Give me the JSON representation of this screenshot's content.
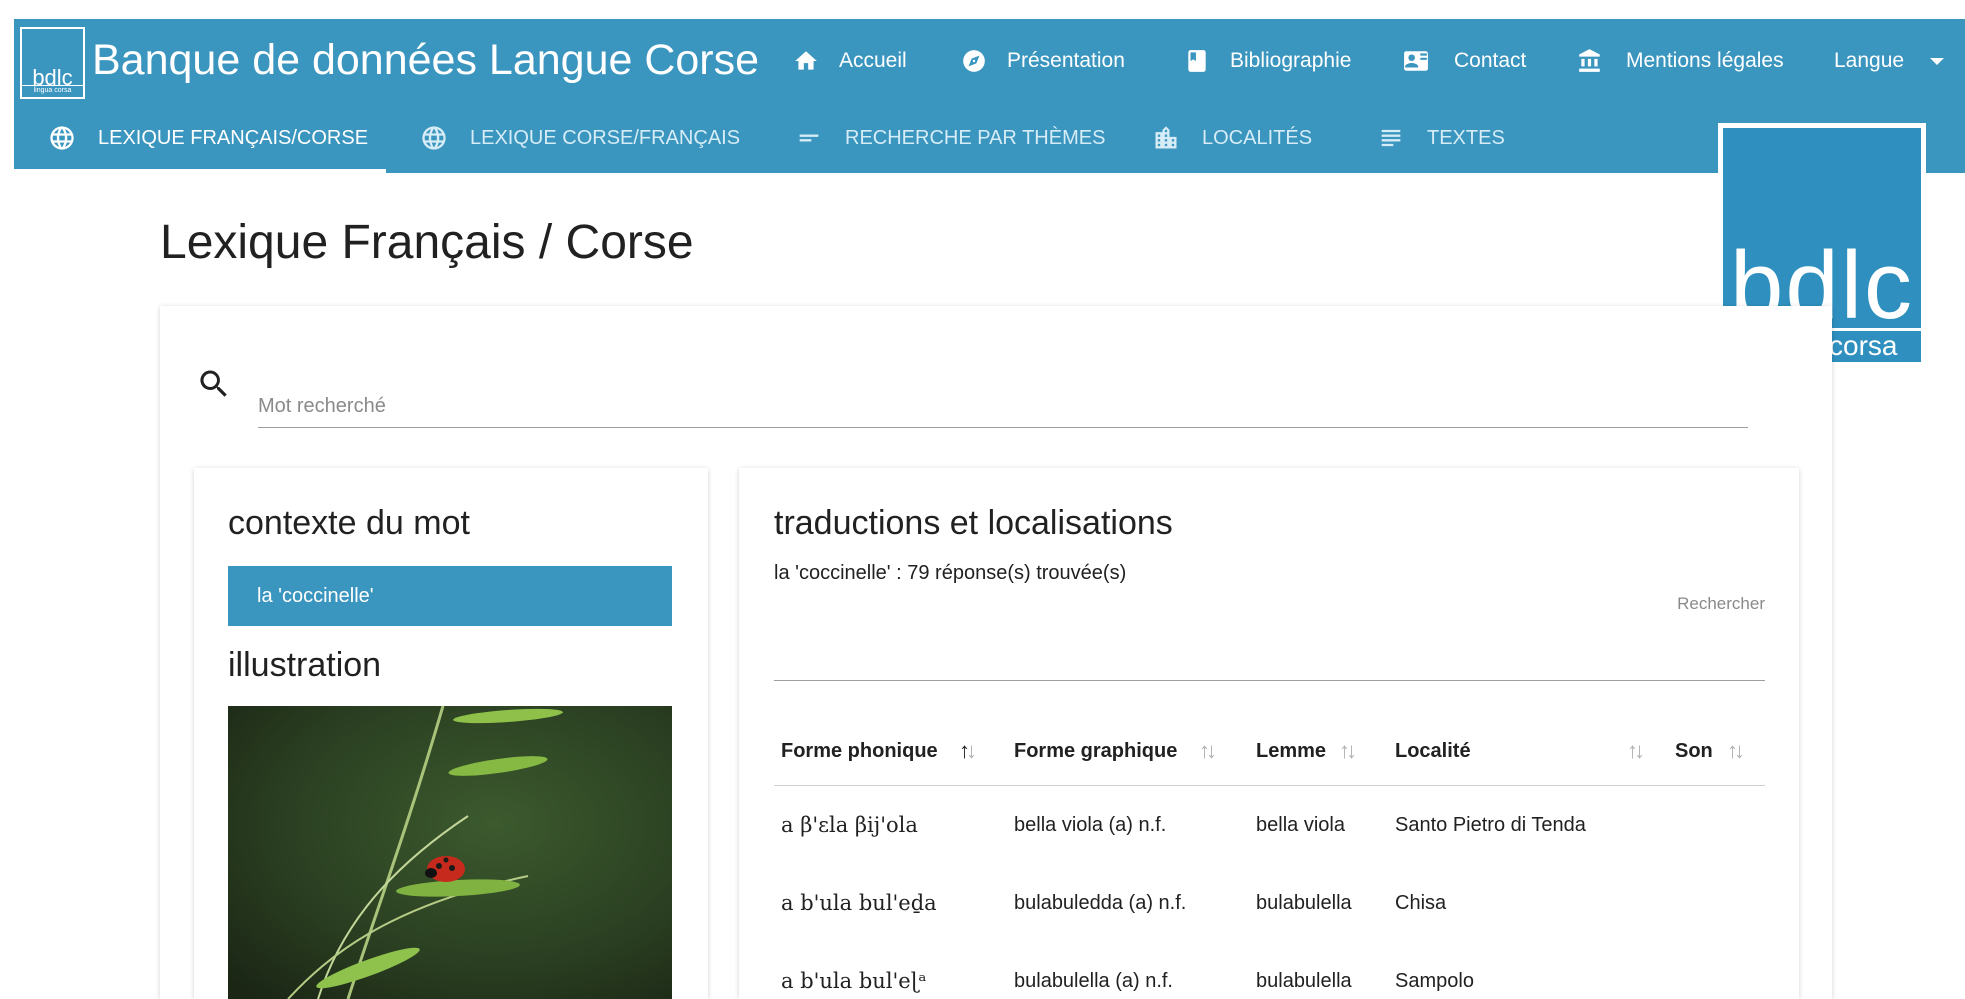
{
  "app": {
    "logo_text": "bdlc",
    "logo_subtext": "lingua corsa",
    "title": "Banque de données Langue Corse"
  },
  "nav": {
    "items": [
      {
        "label": "Accueil",
        "icon": "home-icon"
      },
      {
        "label": "Présentation",
        "icon": "compass-icon"
      },
      {
        "label": "Bibliographie",
        "icon": "book-icon"
      },
      {
        "label": "Contact",
        "icon": "contact-card-icon"
      },
      {
        "label": "Mentions légales",
        "icon": "bank-icon"
      }
    ],
    "language_label": "Langue"
  },
  "tabs": [
    {
      "label": "LEXIQUE FRANÇAIS/CORSE",
      "icon": "globe-icon",
      "active": true
    },
    {
      "label": "LEXIQUE CORSE/FRANÇAIS",
      "icon": "globe-icon",
      "active": false
    },
    {
      "label": "RECHERCHE PAR THÈMES",
      "icon": "short-text-icon",
      "active": false
    },
    {
      "label": "LOCALITÉS",
      "icon": "city-icon",
      "active": false
    },
    {
      "label": "TEXTES",
      "icon": "text-lines-icon",
      "active": false
    }
  ],
  "page": {
    "title": "Lexique Français / Corse"
  },
  "search": {
    "placeholder": "Mot recherché",
    "value": ""
  },
  "context": {
    "heading": "contexte du mot",
    "items": [
      "la 'coccinelle'"
    ],
    "illustration_heading": "illustration"
  },
  "results": {
    "heading": "traductions et localisations",
    "count_text": "la 'coccinelle' : 79 réponse(s) trouvée(s)",
    "search_label": "Rechercher",
    "columns": [
      "Forme phonique",
      "Forme graphique",
      "Lemme",
      "Localité",
      "Son"
    ],
    "rows": [
      {
        "phonique": "a β'ɛla βij'ola",
        "graphique": "bella viola (a) n.f.",
        "lemme": "bella viola",
        "localite": "Santo Pietro di Tenda"
      },
      {
        "phonique": "a b'ula bul'eḏa",
        "graphique": "bulabuledda (a) n.f.",
        "lemme": "bulabulella",
        "localite": "Chisa"
      },
      {
        "phonique": "a b'ula bul'eɭᵃ",
        "graphique": "bulabulella (a) n.f.",
        "lemme": "bulabulella",
        "localite": "Sampolo"
      }
    ]
  },
  "colors": {
    "primary": "#3a95bf",
    "tab_inactive_text": "#d6ecf6",
    "text": "#212121"
  }
}
